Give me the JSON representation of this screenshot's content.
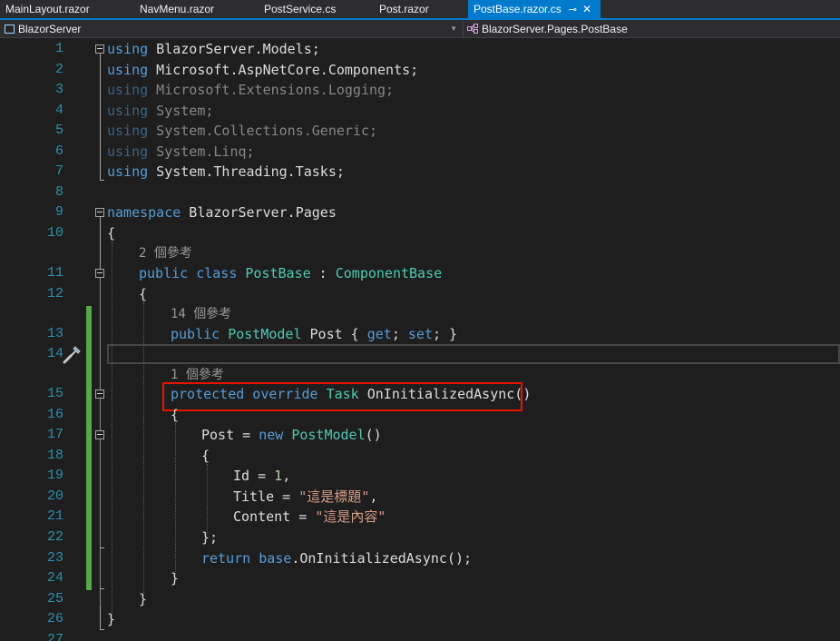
{
  "tabs": [
    {
      "label": "MainLayout.razor"
    },
    {
      "label": "NavMenu.razor"
    },
    {
      "label": "PostService.cs"
    },
    {
      "label": "Post.razor"
    },
    {
      "label": "PostBase.razor.cs",
      "pin": "⊸",
      "close": "✕"
    }
  ],
  "navbar": {
    "project": "BlazorServer",
    "member": "BlazorServer.Pages.PostBase"
  },
  "editor": {
    "line_numbers": [
      "1",
      "2",
      "3",
      "4",
      "5",
      "6",
      "7",
      "8",
      "9",
      "10",
      "11",
      "12",
      "13",
      "14",
      "15",
      "16",
      "17",
      "18",
      "19",
      "20",
      "21",
      "22",
      "23",
      "24",
      "25",
      "26",
      "27"
    ],
    "code": {
      "l1_kw": "using",
      "l1_rest": " BlazorServer.Models;",
      "l2_kw": "using",
      "l2_rest": " Microsoft.AspNetCore.Components;",
      "l3_kw": "using",
      "l3_rest": " Microsoft.Extensions.Logging;",
      "l4_kw": "using",
      "l4_rest": " System;",
      "l5_kw": "using",
      "l5_rest": " System.Collections.Generic;",
      "l6_kw": "using",
      "l6_rest": " System.Linq;",
      "l7_kw": "using",
      "l7_rest": " System.Threading.Tasks;",
      "l9_kw": "namespace",
      "l9_rest": " BlazorServer.Pages",
      "l10": "{",
      "l11_kw": "public class",
      "l11_type": "PostBase",
      "l11_colon": " : ",
      "l11_base": "ComponentBase",
      "l12": "{",
      "l13_kw": "public",
      "l13_type": "PostModel",
      "l13_mid": " Post { ",
      "l13_get": "get",
      "l13_semi": "; ",
      "l13_set": "set",
      "l13_end": "; }",
      "l15_kw": "protected override",
      "l15_type": "Task",
      "l15_rest": " OnInitializedAsync()",
      "l16": "{",
      "l17_pre": "Post = ",
      "l17_kw": "new",
      "l17_type": "PostModel",
      "l17_end": "()",
      "l18": "{",
      "l19_pre": "Id = ",
      "l19_num": "1",
      "l19_end": ",",
      "l20_pre": "Title = ",
      "l20_str": "\"這是標題\"",
      "l20_end": ",",
      "l21_pre": "Content = ",
      "l21_str": "\"這是內容\"",
      "l22": "};",
      "l23_kw": "return",
      "l23_kw2": "base",
      "l23_rest": ".OnInitializedAsync();",
      "l24": "}",
      "l25": "}",
      "l26": "}"
    },
    "lens": {
      "class_refs": "2 個參考",
      "prop_refs": "14 個參考",
      "method_refs": "1 個參考"
    }
  },
  "colors": {
    "keyword": "#569cd6",
    "type": "#4ec9b0",
    "string": "#d69d85",
    "number": "#b5cea8",
    "line_number": "#2b91af",
    "accent": "#007acc",
    "highlight_box": "#e51400",
    "change_bar": "#57a64a"
  }
}
